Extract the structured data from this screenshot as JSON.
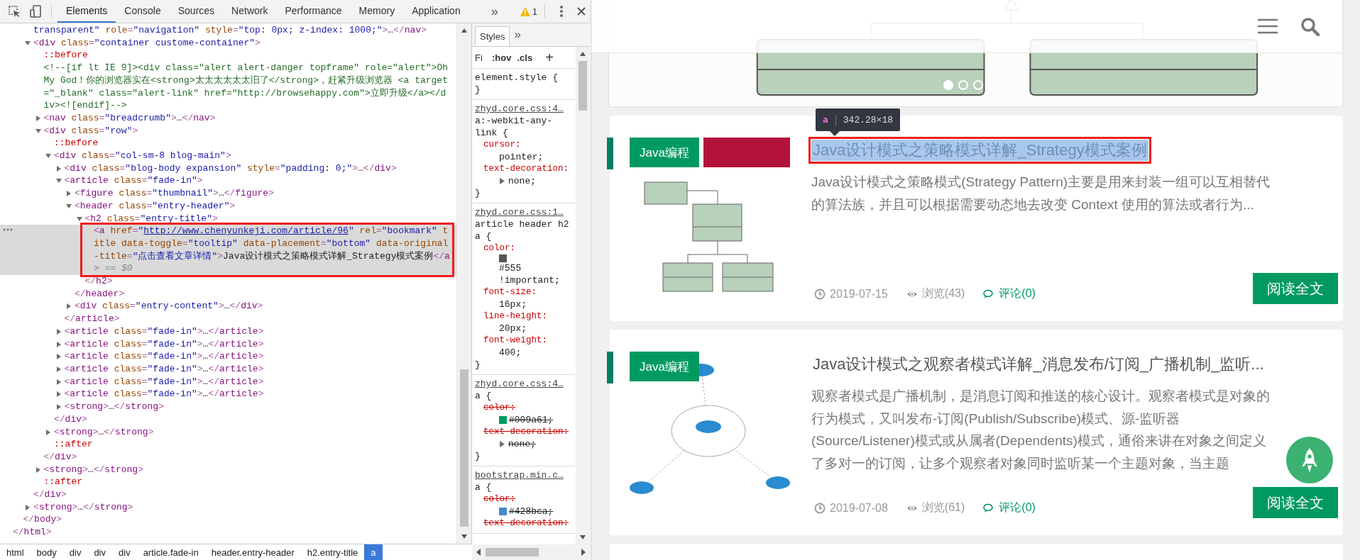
{
  "devtools": {
    "tabs": [
      {
        "label": "Elements",
        "selected": true
      },
      {
        "label": "Console",
        "selected": false
      },
      {
        "label": "Sources",
        "selected": false
      },
      {
        "label": "Network",
        "selected": false
      },
      {
        "label": "Performance",
        "selected": false
      },
      {
        "label": "Memory",
        "selected": false
      },
      {
        "label": "Application",
        "selected": false
      }
    ],
    "overflow": "»",
    "warning_count": "1",
    "dom_tree": [
      {
        "close": "</html>",
        "children": [
          {
            "close": "</body>",
            "children": [
              {
                "continued": true,
                "selected": false,
                "text": "transparent\" role=\"navigation\" style=\"top: 0px; z-index: 1000;\">…</nav>"
              },
              {
                "selected": false,
                "expanded": true,
                "text": "<div class=\"container custome-container\">",
                "close": "</div>",
                "children": [
                  {
                    "kind": "pseudo",
                    "selected": false,
                    "text": "::before"
                  },
                  {
                    "kind": "comment",
                    "selected": false,
                    "text": "<!--[if lt IE 9]><div class=\"alert alert-danger topframe\" role=\"alert\">Oh My God！你的浏览器实在<strong>太太太太太太旧了</strong>，赶紧升级浏览器 <a target=\"_blank\" class=\"alert-link\" href=\"http://browsehappy.com\">立即升级</a></div><![endif]-->"
                  },
                  {
                    "selected": false,
                    "expanded": false,
                    "text": "<nav class=\"breadcrumb\">…</nav>"
                  },
                  {
                    "selected": false,
                    "expanded": true,
                    "text": "<div class=\"row\">",
                    "close": "</div>",
                    "children": [
                      {
                        "kind": "pseudo",
                        "selected": false,
                        "text": "::before"
                      },
                      {
                        "selected": false,
                        "expanded": true,
                        "text": "<div class=\"col-sm-8 blog-main\">",
                        "close": "</div>",
                        "children": [
                          {
                            "selected": false,
                            "expanded": false,
                            "text": "<div class=\"blog-body expansion\" style=\"padding: 0;\">…</div>"
                          },
                          {
                            "selected": false,
                            "expanded": true,
                            "text": "<article class=\"fade-in\">",
                            "close": "</article>",
                            "children": [
                              {
                                "selected": false,
                                "expanded": false,
                                "text": "<figure class=\"thumbnail\">…</figure>"
                              },
                              {
                                "selected": false,
                                "expanded": true,
                                "text": "<header class=\"entry-header\">",
                                "close": "</header>",
                                "children": [
                                  {
                                    "selected": false,
                                    "expanded": true,
                                    "text": "<h2 class=\"entry-title\">",
                                    "close": "</h2>",
                                    "children": [
                                      {
                                        "selected": true,
                                        "text": "<a href=\"",
                                        "link": "http://www.chenyunkeji.com/article/96",
                                        "text_after": "\" rel=\"bookmark\" title data-toggle=\"tooltip\" data-placement=\"bottom\" data-original-title=\"点击查看文章详情\">Java设计模式之策略模式详解_Strategy模式案例</a>",
                                        "console_ref": "== $0"
                                      }
                                    ]
                                  }
                                ]
                              },
                              {
                                "selected": false,
                                "expanded": false,
                                "text": "<div class=\"entry-content\">…</div>"
                              }
                            ]
                          },
                          {
                            "selected": false,
                            "expanded": false,
                            "text": "<article class=\"fade-in\">…</article>"
                          },
                          {
                            "selected": false,
                            "expanded": false,
                            "text": "<article class=\"fade-in\">…</article>"
                          },
                          {
                            "selected": false,
                            "expanded": false,
                            "text": "<article class=\"fade-in\">…</article>"
                          },
                          {
                            "selected": false,
                            "expanded": false,
                            "text": "<article class=\"fade-in\">…</article>"
                          },
                          {
                            "selected": false,
                            "expanded": false,
                            "text": "<article class=\"fade-in\">…</article>"
                          },
                          {
                            "selected": false,
                            "expanded": false,
                            "text": "<article class=\"fade-in\">…</article>"
                          },
                          {
                            "selected": false,
                            "expanded": false,
                            "text": "<strong>…</strong>"
                          }
                        ]
                      },
                      {
                        "selected": false,
                        "expanded": false,
                        "text": "<strong>…</strong>"
                      },
                      {
                        "kind": "pseudo",
                        "selected": false,
                        "text": "::after"
                      }
                    ]
                  },
                  {
                    "selected": false,
                    "expanded": false,
                    "text": "<strong>…</strong>"
                  },
                  {
                    "kind": "pseudo",
                    "selected": false,
                    "text": "::after"
                  }
                ]
              },
              {
                "selected": false,
                "expanded": false,
                "text": "<strong>…</strong>"
              }
            ]
          }
        ]
      }
    ],
    "breadcrumbs": [
      {
        "label": "html",
        "selected": false
      },
      {
        "label": "body",
        "selected": false
      },
      {
        "label": "div",
        "selected": false
      },
      {
        "label": "div",
        "selected": false
      },
      {
        "label": "div",
        "selected": false
      },
      {
        "label": "article.fade-in",
        "selected": false
      },
      {
        "label": "header.entry-header",
        "selected": false
      },
      {
        "label": "h2.entry-title",
        "selected": false
      },
      {
        "label": "a",
        "selected": true
      }
    ],
    "styles": {
      "tabs": [
        {
          "label": "Styles",
          "selected": true
        }
      ],
      "overflow": "»",
      "filter": {
        "placeholder": "Fi"
      },
      "hov": ":hov",
      "cls": ".cls",
      "add": "+",
      "rules": [
        {
          "selector": "element.style {",
          "end": "}"
        },
        {
          "source": "zhyd.core.css:4…",
          "selector": "a:-webkit-any-link {",
          "props": [
            {
              "name": "cursor:",
              "value": "pointer;",
              "struck": false
            },
            {
              "name": "text-decoration:",
              "value": "none;",
              "struck": false,
              "expandable": true
            }
          ],
          "end": "}"
        },
        {
          "source": "zhyd.core.css:1…",
          "selector": "article header h2 a {",
          "props": [
            {
              "name": "color:",
              "value": "#555 !important;",
              "struck": false,
              "color": "#555555"
            },
            {
              "name": "font-size:",
              "value": "16px;",
              "struck": false
            },
            {
              "name": "line-height:",
              "value": "20px;",
              "struck": false
            },
            {
              "name": "font-weight:",
              "value": "400;",
              "struck": false
            }
          ],
          "end": "}"
        },
        {
          "source": "zhyd.core.css:4…",
          "selector": "a {",
          "props": [
            {
              "name": "color:",
              "value": "#009a61;",
              "struck": true,
              "color": "#009a61"
            },
            {
              "name": "text-decoration:",
              "value": "none;",
              "struck": true,
              "expandable": true
            }
          ],
          "end": "}"
        },
        {
          "source": "bootstrap.min.c…",
          "selector": "a {",
          "props": [
            {
              "name": "color:",
              "value": "#428bca;",
              "struck": true,
              "color": "#428bca"
            },
            {
              "name": "text-decoration:",
              "struck": true
            }
          ]
        }
      ]
    }
  },
  "page": {
    "carousel": {
      "kind": "picture",
      "dots": [
        {
          "selected": true
        },
        {
          "selected": false
        },
        {
          "selected": false
        }
      ]
    },
    "tooltip": {
      "tag": "a",
      "size": "342.28×18"
    },
    "articles": [
      {
        "category": "Java编程",
        "title": "Java设计模式之策略模式详解_Strategy模式案例",
        "highlighted": true,
        "summary": "Java设计模式之策略模式(Strategy Pattern)主要是用来封装一组可以互相替代的算法族，并且可以根据需要动态地去改变 Context 使用的算法或者行为...",
        "date": "2019-07-15",
        "views": "浏览(43)",
        "comments": "评论(0)",
        "read_more": "阅读全文"
      },
      {
        "category": "Java编程",
        "title": "Java设计模式之观察者模式详解_消息发布/订阅_广播机制_监听...",
        "highlighted": false,
        "summary": "观察者模式是广播机制，是消息订阅和推送的核心设计。观察者模式是对象的行为模式，又叫发布-订阅(Publish/Subscribe)模式、源-监听器(Source/Listener)模式或从属者(Dependents)模式，通俗来讲在对象之间定义了多对一的订阅，让多个观察者对象同时监听某一个主题对象，当主题",
        "date": "2019-07-08",
        "views": "浏览(61)",
        "comments": "评论(0)",
        "read_more": "阅读全文"
      }
    ]
  }
}
